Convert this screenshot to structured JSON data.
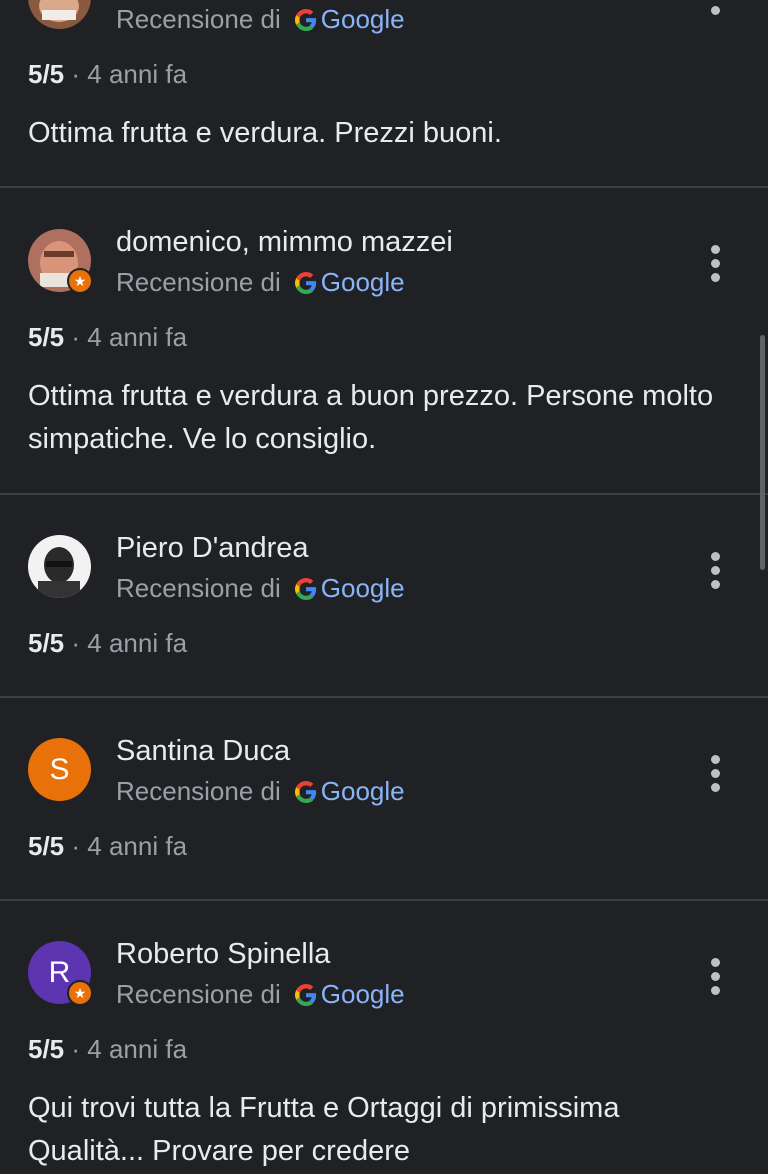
{
  "common": {
    "source_prefix": "Recensione di",
    "source_brand": "Google"
  },
  "reviews": [
    {
      "author": "",
      "avatar_letter": "",
      "rating": "5/5",
      "time": "4 anni fa",
      "text": "Ottima frutta e verdura. Prezzi buoni."
    },
    {
      "author": "domenico, mimmo mazzei",
      "avatar_letter": "",
      "rating": "5/5",
      "time": "4 anni fa",
      "text": "Ottima frutta e verdura a buon prezzo. Persone molto simpatiche. Ve lo consiglio."
    },
    {
      "author": "Piero D'andrea",
      "avatar_letter": "",
      "rating": "5/5",
      "time": "4 anni fa",
      "text": ""
    },
    {
      "author": "Santina Duca",
      "avatar_letter": "S",
      "avatar_color": "#e8710a",
      "rating": "5/5",
      "time": "4 anni fa",
      "text": ""
    },
    {
      "author": "Roberto Spinella",
      "avatar_letter": "R",
      "avatar_color": "#5e35b1",
      "rating": "5/5",
      "time": "4 anni fa",
      "text": "Qui trovi tutta la Frutta e Ortaggi di primissima Qualità... Provare per credere"
    }
  ],
  "colors": {
    "background": "#202124",
    "divider": "#3c4043",
    "google_link": "#8ab4f8",
    "local_guide_badge": "#e8710a"
  },
  "icons": {
    "menu": "more-vert-icon",
    "google": "google-g-icon",
    "badge": "local-guide-star-icon"
  }
}
